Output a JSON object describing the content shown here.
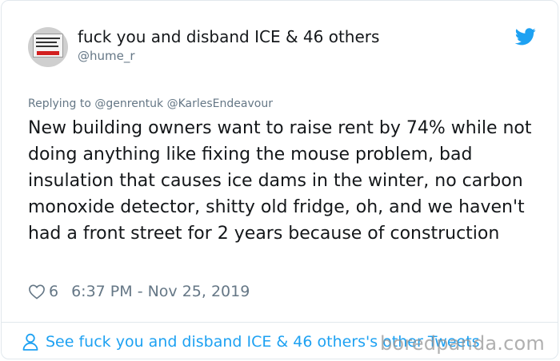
{
  "tweet": {
    "display_name": "fuck you and disband ICE & 46 others",
    "handle": "@hume_r",
    "replying_to": "Replying to @genrentuk @KarlesEndeavour",
    "text": "New building owners want to raise rent by 74% while not doing anything like fixing the mouse problem, bad insulation that causes ice dams in the winter, no carbon monoxide detector, shitty old fridge, oh, and we haven't had a front street for 2 years because of construction",
    "likes": "6",
    "timestamp": "6:37 PM - Nov 25, 2019",
    "footer_link": "See fuck you and disband ICE & 46 others's other Tweets"
  },
  "icons": {
    "brand": "twitter-bird-icon",
    "like": "heart-icon",
    "profile": "user-icon"
  },
  "colors": {
    "brand_blue": "#1da1f2",
    "text_primary": "#14171a",
    "text_secondary": "#657786",
    "border": "#e1e8ed"
  },
  "watermark": "boredpanda.com"
}
